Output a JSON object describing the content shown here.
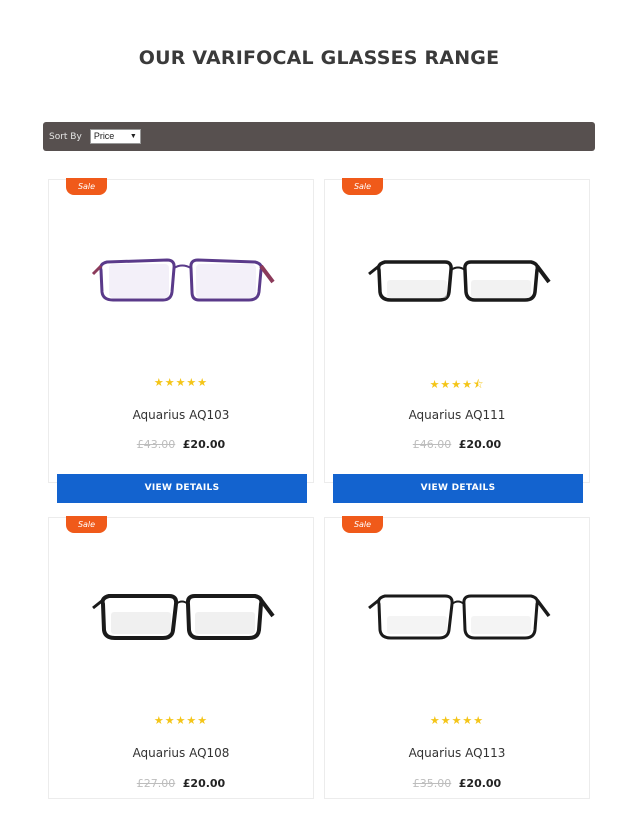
{
  "page": {
    "title": "OUR VARIFOCAL GLASSES RANGE"
  },
  "sort": {
    "label": "Sort By",
    "selected": "Price",
    "arrow": "▼"
  },
  "products": [
    {
      "sale": "Sale",
      "stars": "★★★★★",
      "rating": 5,
      "name": "Aquarius AQ103",
      "old_price": "£43.00",
      "price": "£20.00",
      "button": "VIEW DETAILS",
      "frame_color": "#5a3a8a"
    },
    {
      "sale": "Sale",
      "stars": "★★★★⯪",
      "rating": 4.5,
      "name": "Aquarius AQ111",
      "old_price": "£46.00",
      "price": "£20.00",
      "button": "VIEW DETAILS",
      "frame_color": "#1a1a1a"
    },
    {
      "sale": "Sale",
      "stars": "★★★★★",
      "rating": 5,
      "name": "Aquarius AQ108",
      "old_price": "£27.00",
      "price": "£20.00",
      "frame_color": "#1a1a1a"
    },
    {
      "sale": "Sale",
      "stars": "★★★★★",
      "rating": 5,
      "name": "Aquarius AQ113",
      "old_price": "£35.00",
      "price": "£20.00",
      "frame_color": "#1a1a1a"
    }
  ],
  "colors": {
    "sale_badge": "#f05a1a",
    "button": "#1363cf",
    "sort_bar": "#57504f",
    "stars": "#f4c518"
  }
}
